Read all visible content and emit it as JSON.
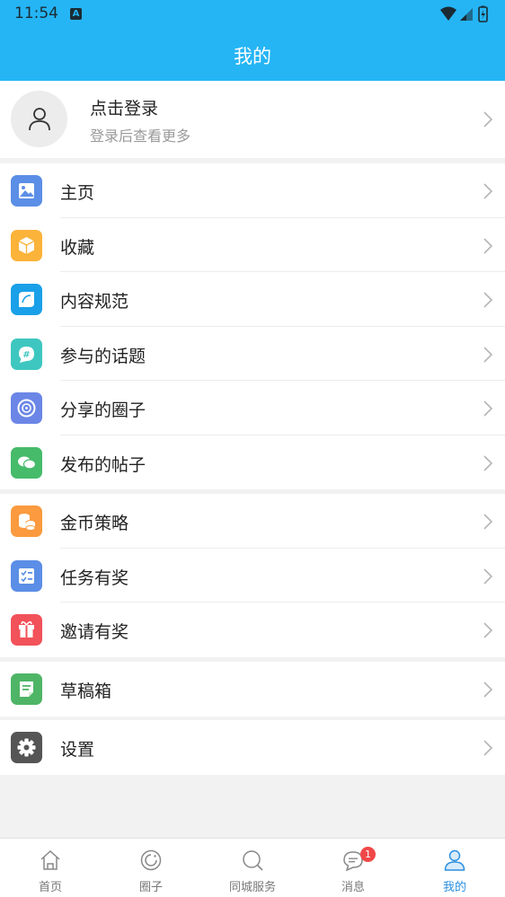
{
  "status_bar": {
    "time": "11:54",
    "notification_icon": "A"
  },
  "header": {
    "title": "我的"
  },
  "login": {
    "title": "点击登录",
    "subtitle": "登录后查看更多"
  },
  "groups": [
    {
      "items": [
        {
          "label": "主页",
          "icon": "image-icon",
          "color": "#5b8ee6"
        },
        {
          "label": "收藏",
          "icon": "box-icon",
          "color": "#fbb33a"
        },
        {
          "label": "内容规范",
          "icon": "shield-icon",
          "color": "#1aa0e8"
        },
        {
          "label": "参与的话题",
          "icon": "hashtag-icon",
          "color": "#3ec7c0"
        },
        {
          "label": "分享的圈子",
          "icon": "circle-icon",
          "color": "#6b86e6"
        },
        {
          "label": "发布的帖子",
          "icon": "chat-icon",
          "color": "#46bb6a"
        }
      ]
    },
    {
      "items": [
        {
          "label": "金币策略",
          "icon": "coins-icon",
          "color": "#fb9a3e"
        },
        {
          "label": "任务有奖",
          "icon": "checklist-icon",
          "color": "#5b8ee6"
        },
        {
          "label": "邀请有奖",
          "icon": "gift-icon",
          "color": "#f2525a"
        }
      ]
    },
    {
      "items": [
        {
          "label": "草稿箱",
          "icon": "draft-icon",
          "color": "#4fb566"
        }
      ]
    },
    {
      "items": [
        {
          "label": "设置",
          "icon": "gear-icon",
          "color": "#555555"
        }
      ]
    }
  ],
  "tabs": [
    {
      "label": "首页",
      "icon": "home-icon"
    },
    {
      "label": "圈子",
      "icon": "circle-tab-icon"
    },
    {
      "label": "同城服务",
      "icon": "search-tab-icon"
    },
    {
      "label": "消息",
      "icon": "message-icon",
      "badge": "1"
    },
    {
      "label": "我的",
      "icon": "user-tab-icon",
      "active": true
    }
  ],
  "colors": {
    "accent": "#25b5f5",
    "active_tab": "#2a8fe0",
    "badge": "#f04848"
  }
}
